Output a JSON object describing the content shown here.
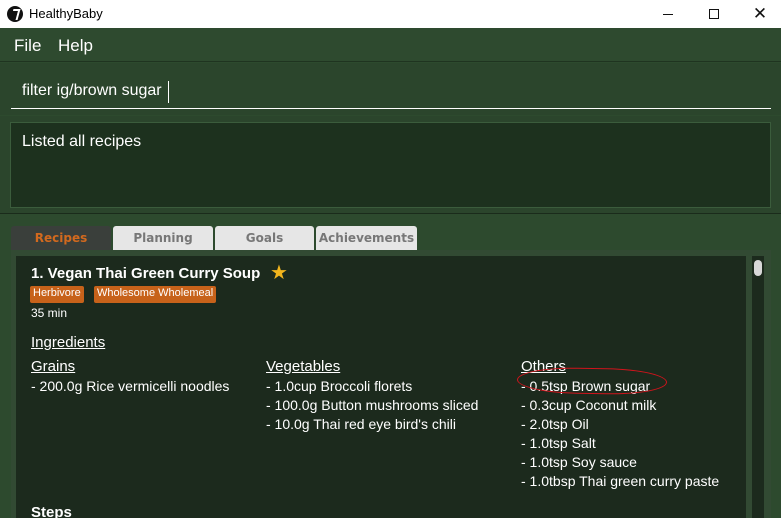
{
  "window": {
    "title": "HealthyBaby",
    "minimize_label": "",
    "maximize_label": "",
    "close_label": "✕"
  },
  "menu": {
    "file": "File",
    "help": "Help"
  },
  "command": {
    "value": "filter ig/brown sugar"
  },
  "result": {
    "text": "Listed all recipes"
  },
  "tabs": [
    {
      "label": "Recipes",
      "active": true
    },
    {
      "label": "Planning",
      "active": false
    },
    {
      "label": "Goals",
      "active": false
    },
    {
      "label": "Achievements",
      "active": false
    }
  ],
  "recipe": {
    "title": "1.  Vegan Thai Green Curry Soup",
    "favourite_icon": "star-icon",
    "tags": [
      "Herbivore",
      "Wholesome Wholemeal"
    ],
    "time": "35 min",
    "ingredients_header": "Ingredients",
    "groups": [
      {
        "name": "Grains",
        "items": [
          "- 200.0g Rice vermicelli noodles"
        ]
      },
      {
        "name": "Vegetables",
        "items": [
          "- 1.0cup Broccoli florets",
          "- 100.0g Button mushrooms sliced",
          "- 10.0g Thai red eye bird's chili"
        ]
      },
      {
        "name": "Others",
        "items": [
          "- 0.5tsp Brown sugar",
          "- 0.3cup Coconut milk",
          "- 2.0tsp Oil",
          "- 1.0tsp Salt",
          "- 1.0tsp Soy sauce",
          "- 1.0tbsp Thai green curry paste"
        ]
      }
    ],
    "steps_header": "Steps"
  },
  "colors": {
    "background": "#2d4a2e",
    "card": "#1c2a1d",
    "tag": "#c7621a",
    "active_tab_text": "#d2691e",
    "annotation": "#d0141c"
  }
}
